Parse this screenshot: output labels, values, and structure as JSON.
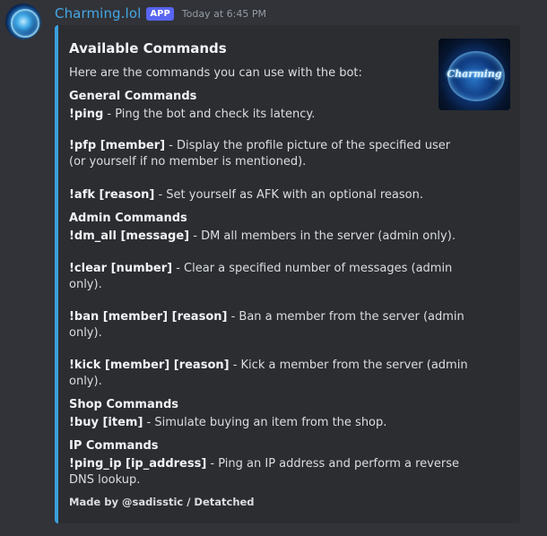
{
  "author": {
    "username": "Charming.lol",
    "badge": "APP",
    "timestamp": "Today at 6:45 PM"
  },
  "embed": {
    "color": "#3ca0dc",
    "title": "Available Commands",
    "description": "Here are the commands you can use with the bot:",
    "thumbnail_text": "Charming",
    "sections": {
      "general": "General Commands",
      "admin": "Admin Commands",
      "shop": "Shop Commands",
      "ip": "IP Commands"
    },
    "commands": {
      "ping": {
        "name": "!ping",
        "desc": " - Ping the bot and check its latency."
      },
      "pfp": {
        "name": "!pfp [member]",
        "desc1": " - Display the profile picture of the specified user",
        "desc2": "(or yourself if no member is mentioned)."
      },
      "afk": {
        "name": "!afk [reason]",
        "desc": " - Set yourself as AFK with an optional reason."
      },
      "dm_all": {
        "name": "!dm_all [message]",
        "desc": " - DM all members in the server (admin only)."
      },
      "clear": {
        "name": "!clear [number]",
        "desc1": " - Clear a specified number of messages (admin",
        "desc2": "only)."
      },
      "ban": {
        "name": "!ban [member] [reason]",
        "desc1": " - Ban a member from the server (admin",
        "desc2": "only)."
      },
      "kick": {
        "name": "!kick [member] [reason]",
        "desc1": " - Kick a member from the server (admin",
        "desc2": "only)."
      },
      "buy": {
        "name": "!buy [item]",
        "desc": " - Simulate buying an item from the shop."
      },
      "ping_ip": {
        "name": "!ping_ip [ip_address]",
        "desc1": " - Ping an IP address and perform a reverse",
        "desc2": "DNS lookup."
      }
    },
    "footer": "Made by @sadisstic / Detatched"
  }
}
